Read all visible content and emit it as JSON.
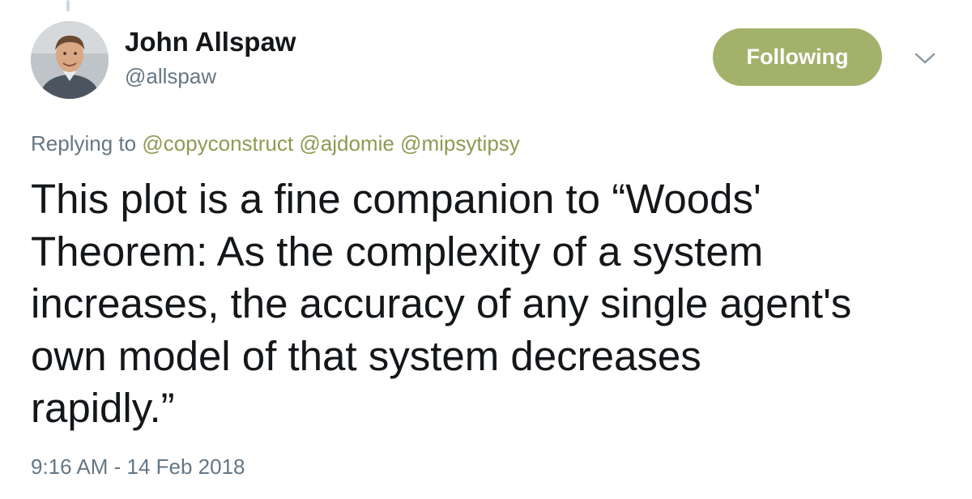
{
  "tweet": {
    "author": {
      "display_name": "John Allspaw",
      "handle": "@allspaw",
      "avatar_icon": "profile-photo"
    },
    "follow_button_label": "Following",
    "more_menu_icon": "chevron-down-icon",
    "reply_context": {
      "prefix": "Replying to",
      "mentions": [
        "@copyconstruct",
        "@ajdomie",
        "@mipsytipsy"
      ]
    },
    "text_lines": [
      "This plot is a fine companion to “Woods'",
      "Theorem: As the complexity of a system",
      "increases, the accuracy of any single agent's",
      "own model of that system decreases",
      "rapidly.”"
    ],
    "timestamp": "9:16 AM - 14 Feb 2018"
  },
  "colors": {
    "follow_button_bg": "#a3b26b",
    "mention": "#8c9b52",
    "secondary_text": "#657786",
    "primary_text": "#14171a"
  }
}
